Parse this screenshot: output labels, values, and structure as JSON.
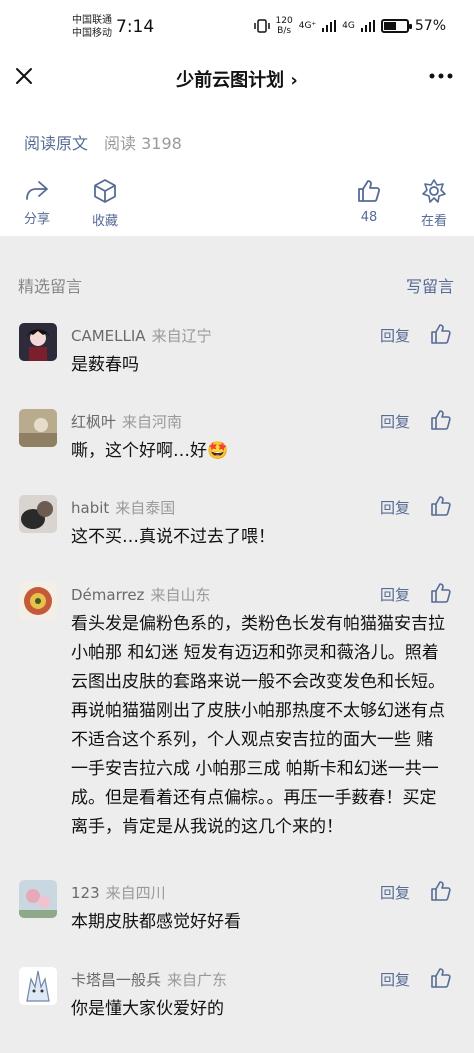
{
  "status_bar": {
    "carrier_1": "中国联通",
    "carrier_2": "中国移动",
    "time": "7:14",
    "net_speed_value": "120",
    "net_speed_unit": "B/s",
    "signal_1": "4G⁺",
    "signal_2": "4G",
    "battery": "57%",
    "battery_level": 0.57
  },
  "nav": {
    "title": "少前云图计划 ›",
    "close_icon": "close-icon",
    "more_icon": "more-dots-icon"
  },
  "meta": {
    "read_original": "阅读原文",
    "read_count": "阅读 3198"
  },
  "actions": {
    "share": "分享",
    "favorite": "收藏",
    "like_count": "48",
    "watching": "在看"
  },
  "comments_section": {
    "title": "精选留言",
    "write": "写留言"
  },
  "comments": [
    {
      "name": "CAMELLIA",
      "location": "来自辽宁",
      "text": "是薮春吗",
      "reply": "回复"
    },
    {
      "name": "红枫叶",
      "location": "来自河南",
      "text": "嘶，这个好啊…好🤩",
      "reply": "回复"
    },
    {
      "name": "habit",
      "location": "来自泰国",
      "text": "这不买…真说不过去了喂！",
      "reply": "回复"
    },
    {
      "name": "Démarrez",
      "location": "来自山东",
      "text": "看头发是偏粉色系的，类粉色长发有帕猫猫安吉拉 小帕那 和幻迷 短发有迈迈和弥灵和薇洛儿。照着云图出皮肤的套路来说一般不会改变发色和长短。再说帕猫猫刚出了皮肤小帕那热度不太够幻迷有点不适合这个系列，个人观点安吉拉的面大一些 赌一手安吉拉六成 小帕那三成 帕斯卡和幻迷一共一成。但是看着还有点偏棕。。再压一手薮春！买定离手，肯定是从我说的这几个来的！",
      "reply": "回复"
    },
    {
      "name": "123",
      "location": "来自四川",
      "text": "本期皮肤都感觉好好看",
      "reply": "回复"
    },
    {
      "name": "卡塔昌一般兵",
      "location": "来自广东",
      "text": "你是懂大家伙爱好的",
      "reply": "回复"
    }
  ],
  "colors": {
    "link": "#576b95",
    "background": "#ededed",
    "card": "#ffffff"
  }
}
